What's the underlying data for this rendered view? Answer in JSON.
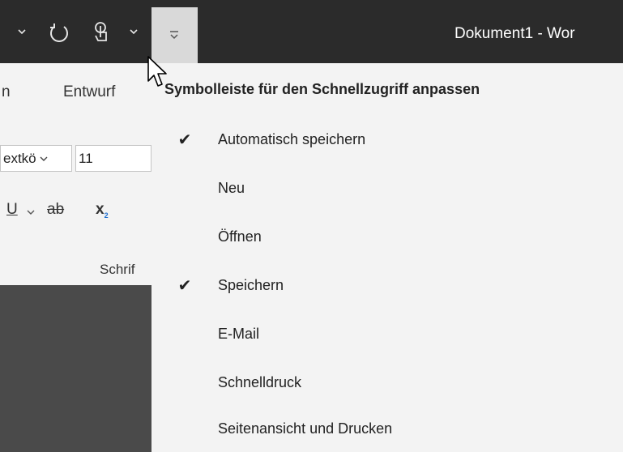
{
  "window": {
    "title": "Dokument1 - Wor"
  },
  "quick_access_toolbar": {
    "icons": [
      "chevron-down-icon",
      "redo-icon",
      "touch-mode-icon",
      "chevron-down-icon",
      "customize-qat-icon"
    ]
  },
  "ribbon": {
    "tab_left_partial": "n",
    "tab_entwurf": "Entwurf",
    "font_name": "extkö",
    "font_size": "11",
    "underline": "U",
    "strikethrough": "ab",
    "subscript": "x",
    "subscript_small": "2",
    "group_label": "Schrif"
  },
  "menu": {
    "header": "Symbolleiste für den Schnellzugriff anpassen",
    "items": [
      {
        "label": "Automatisch speichern",
        "checked": true
      },
      {
        "label": "Neu",
        "checked": false
      },
      {
        "label": "Öffnen",
        "checked": false
      },
      {
        "label": "Speichern",
        "checked": true
      },
      {
        "label": "E-Mail",
        "checked": false
      },
      {
        "label": "Schnelldruck",
        "checked": false
      },
      {
        "label": "Seitenansicht und Drucken",
        "checked": false
      }
    ],
    "check_glyph": "✔"
  },
  "colors": {
    "titlebar": "#2b2b2b",
    "menu_background": "#f3f3f3",
    "active_button": "#d9d9d9",
    "workspace": "#4a4a4a"
  }
}
